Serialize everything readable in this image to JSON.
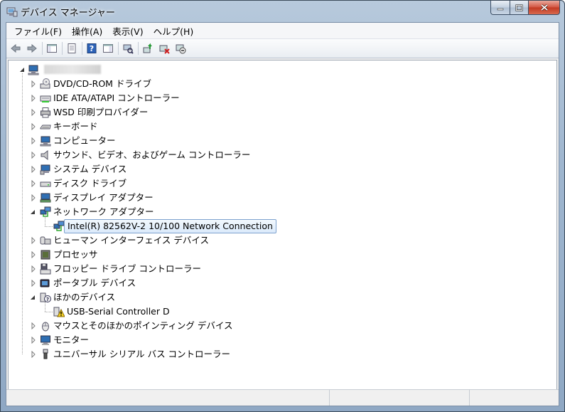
{
  "window": {
    "title": "デバイス マネージャー"
  },
  "menu": [
    {
      "id": "file",
      "label": "ファイル(F)"
    },
    {
      "id": "action",
      "label": "操作(A)"
    },
    {
      "id": "view",
      "label": "表示(V)"
    },
    {
      "id": "help",
      "label": "ヘルプ(H)"
    }
  ],
  "toolbar": [
    {
      "name": "back-arrow-icon"
    },
    {
      "name": "forward-arrow-icon"
    },
    {
      "sep": true
    },
    {
      "name": "show-hide-console-tree-icon"
    },
    {
      "sep": true
    },
    {
      "name": "properties-icon"
    },
    {
      "sep": true
    },
    {
      "name": "help-icon"
    },
    {
      "name": "action-pane-icon"
    },
    {
      "sep": true
    },
    {
      "name": "scan-hardware-icon"
    },
    {
      "sep": true
    },
    {
      "name": "update-driver-icon"
    },
    {
      "name": "uninstall-device-icon"
    },
    {
      "name": "disable-device-icon"
    }
  ],
  "tree": {
    "items": [
      {
        "label": "DVD/CD-ROM ドライブ",
        "icon": "dvd-drive-icon",
        "expanded": false
      },
      {
        "label": "IDE ATA/ATAPI コントローラー",
        "icon": "ide-controller-icon",
        "expanded": false
      },
      {
        "label": "WSD 印刷プロバイダー",
        "icon": "printer-icon",
        "expanded": false
      },
      {
        "label": "キーボード",
        "icon": "keyboard-icon",
        "expanded": false
      },
      {
        "label": "コンピューター",
        "icon": "computer-icon",
        "expanded": false
      },
      {
        "label": "サウンド、ビデオ、およびゲーム コントローラー",
        "icon": "speaker-icon",
        "expanded": false
      },
      {
        "label": "システム デバイス",
        "icon": "system-device-icon",
        "expanded": false
      },
      {
        "label": "ディスク ドライブ",
        "icon": "disk-drive-icon",
        "expanded": false
      },
      {
        "label": "ディスプレイ アダプター",
        "icon": "display-adapter-icon",
        "expanded": false
      },
      {
        "label": "ネットワーク アダプター",
        "icon": "network-adapter-icon",
        "expanded": true,
        "children": [
          {
            "label": "Intel(R) 82562V-2 10/100 Network Connection",
            "icon": "network-adapter-icon",
            "selected": true
          }
        ]
      },
      {
        "label": "ヒューマン インターフェイス デバイス",
        "icon": "hid-icon",
        "expanded": false
      },
      {
        "label": "プロセッサ",
        "icon": "processor-icon",
        "expanded": false
      },
      {
        "label": "フロッピー ドライブ コントローラー",
        "icon": "floppy-controller-icon",
        "expanded": false
      },
      {
        "label": "ポータブル デバイス",
        "icon": "portable-device-icon",
        "expanded": false
      },
      {
        "label": "ほかのデバイス",
        "icon": "unknown-device-icon",
        "expanded": true,
        "children": [
          {
            "label": "USB-Serial Controller D",
            "icon": "warning-device-icon",
            "selected": false
          }
        ]
      },
      {
        "label": "マウスとそのほかのポインティング デバイス",
        "icon": "mouse-icon",
        "expanded": false
      },
      {
        "label": "モニター",
        "icon": "monitor-icon",
        "expanded": false
      },
      {
        "label": "ユニバーサル シリアル バス コントローラー",
        "icon": "usb-icon",
        "expanded": false
      }
    ]
  },
  "colors": {
    "selection_border": "#7da2ce",
    "selection_fill": "#dbeafb",
    "title_bar": "#9fb6cf",
    "close_button": "#c23a22"
  }
}
